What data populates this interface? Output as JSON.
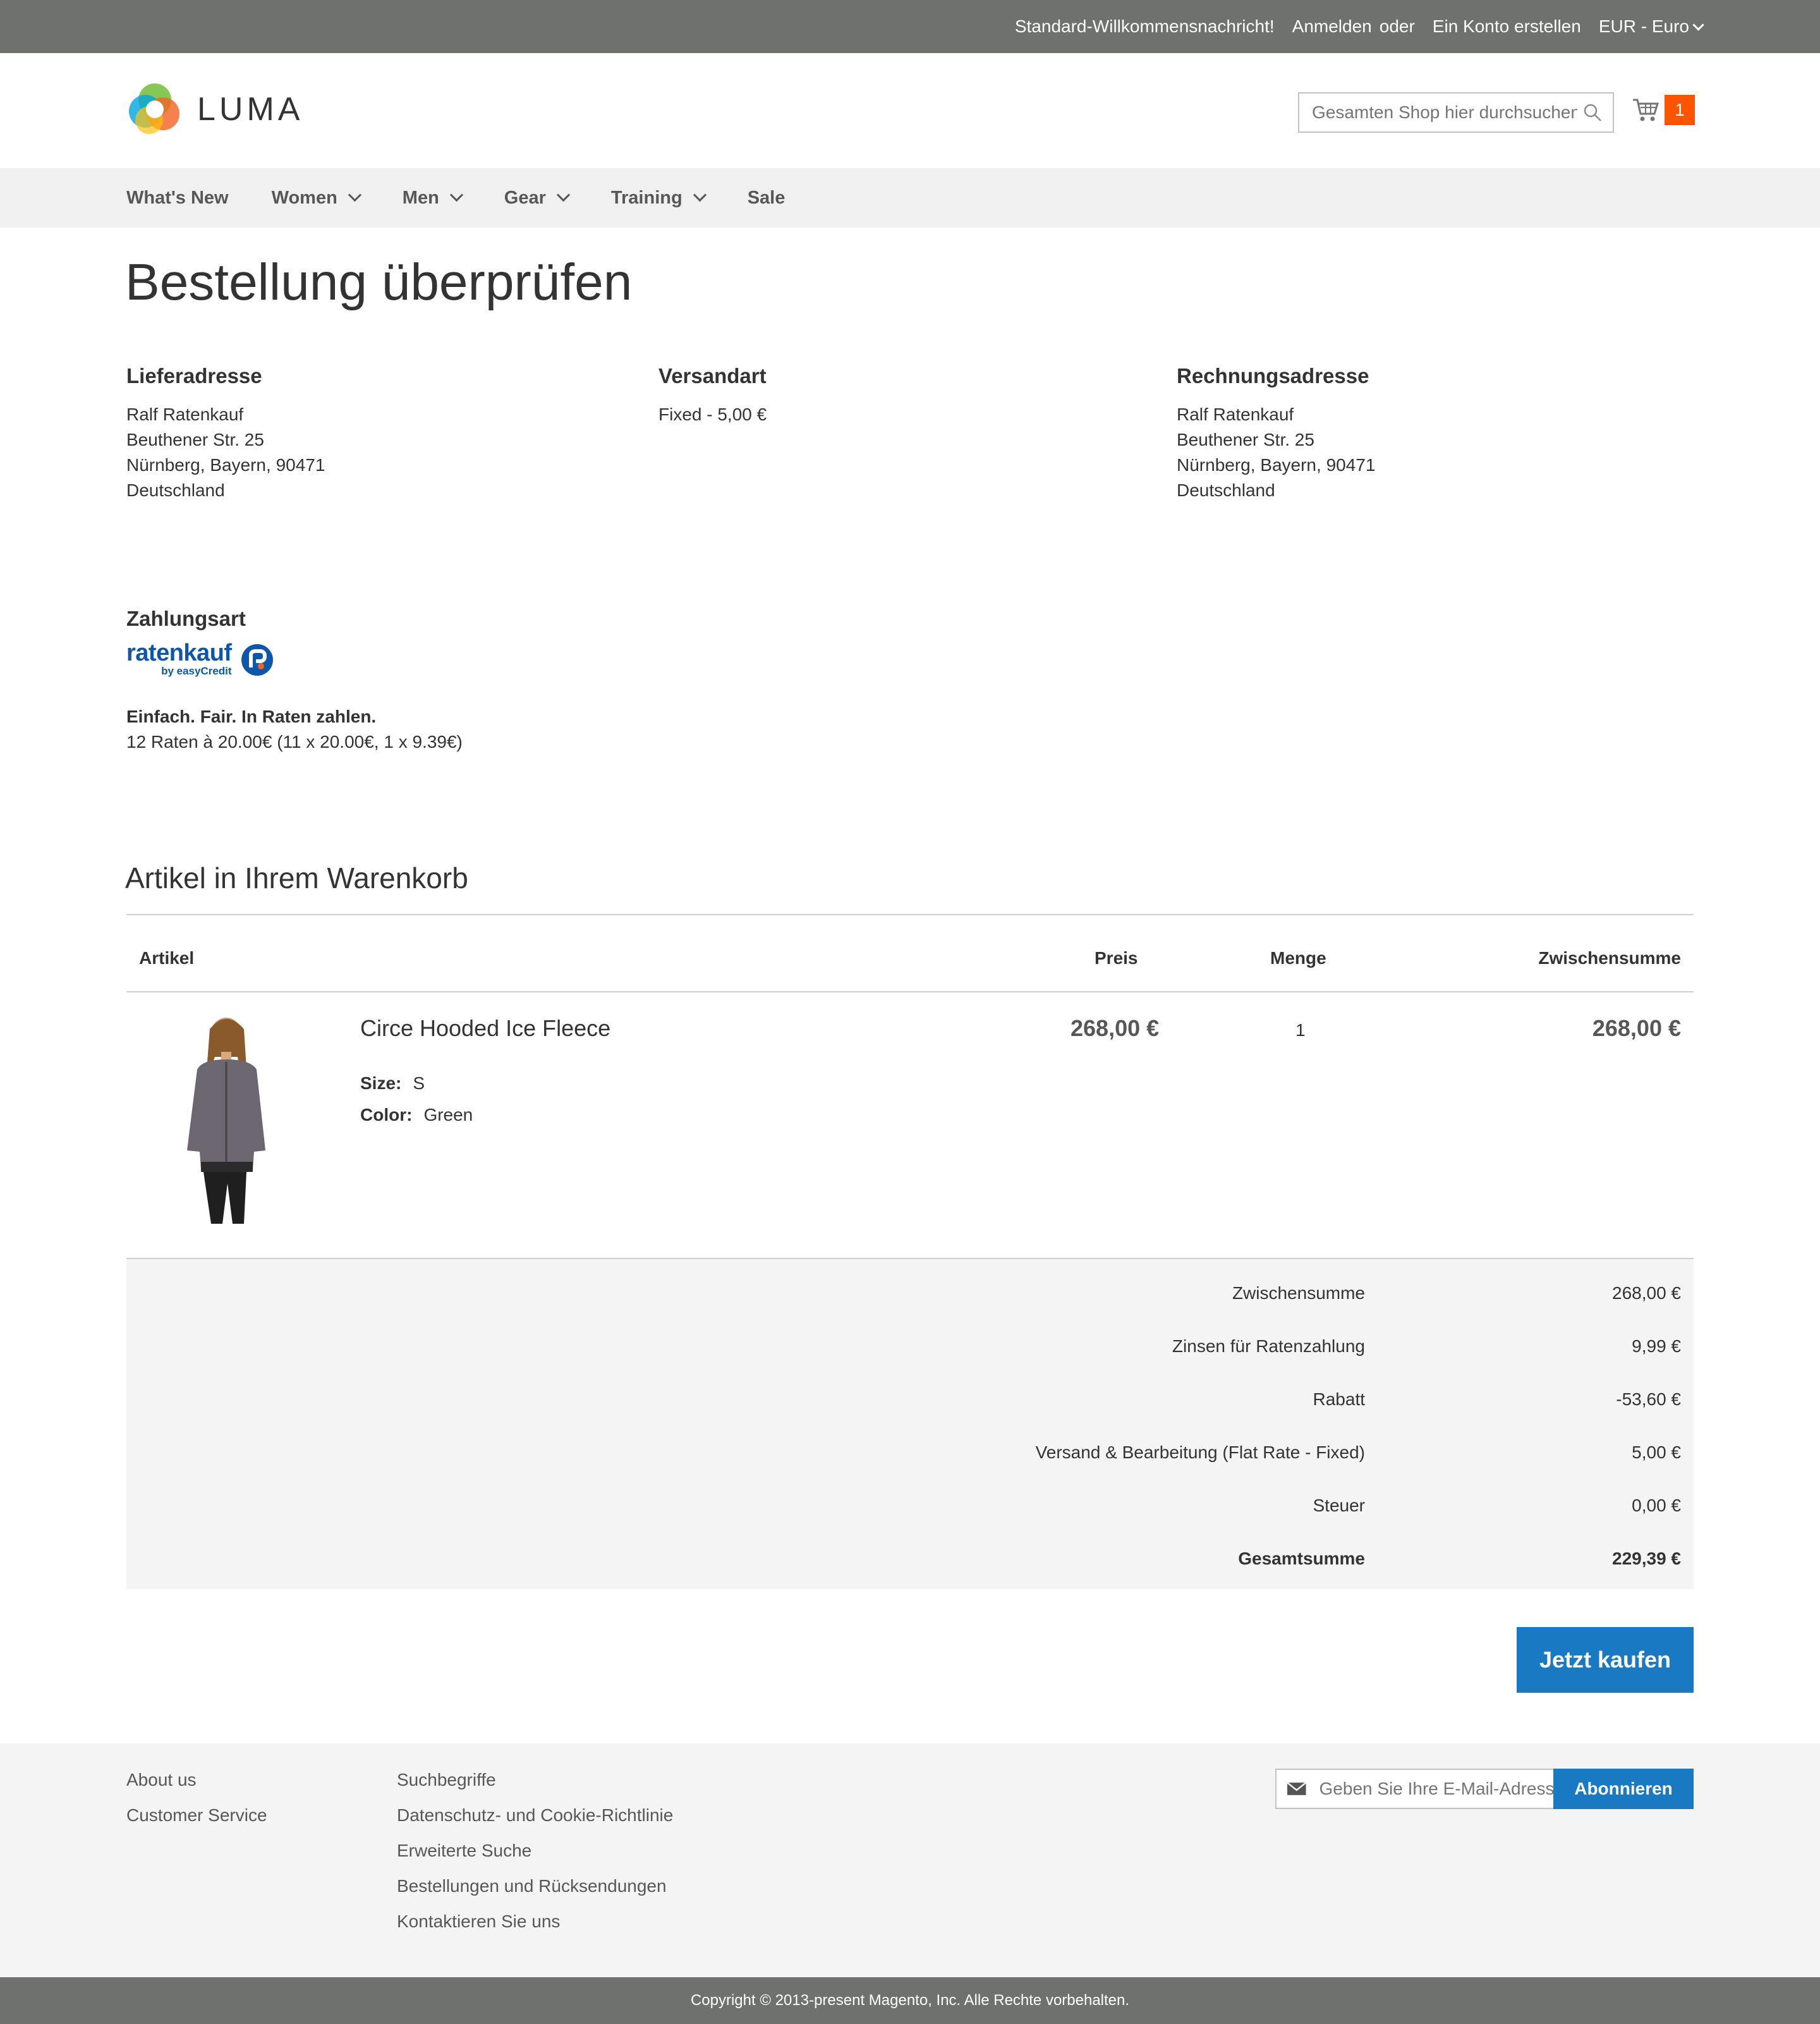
{
  "topbar": {
    "welcome": "Standard-Willkommensnachricht!",
    "login": "Anmelden",
    "or": "oder",
    "create_account": "Ein Konto erstellen",
    "currency": "EUR - Euro"
  },
  "header": {
    "logo_text": "LUMA",
    "search_placeholder": "Gesamten Shop hier durchsuchen...",
    "cart_count": "1"
  },
  "nav": {
    "items": [
      {
        "label": "What's New",
        "dropdown": false
      },
      {
        "label": "Women",
        "dropdown": true
      },
      {
        "label": "Men",
        "dropdown": true
      },
      {
        "label": "Gear",
        "dropdown": true
      },
      {
        "label": "Training",
        "dropdown": true
      },
      {
        "label": "Sale",
        "dropdown": false
      }
    ]
  },
  "page_title": "Bestellung überprüfen",
  "shipping_address": {
    "title": "Lieferadresse",
    "lines": [
      "Ralf Ratenkauf",
      "Beuthener Str. 25",
      "Nürnberg, Bayern, 90471",
      "Deutschland"
    ]
  },
  "shipping_method": {
    "title": "Versandart",
    "value": "Fixed - 5,00 €"
  },
  "billing_address": {
    "title": "Rechnungsadresse",
    "lines": [
      "Ralf Ratenkauf",
      "Beuthener Str. 25",
      "Nürnberg, Bayern, 90471",
      "Deutschland"
    ]
  },
  "payment": {
    "title": "Zahlungsart",
    "logo_text": "ratenkauf",
    "logo_sub": "by easyCredit",
    "tagline": "Einfach. Fair. In Raten zahlen.",
    "installments": "12 Raten à 20.00€ (11 x 20.00€, 1 x 9.39€)"
  },
  "cart": {
    "title": "Artikel in Ihrem Warenkorb",
    "columns": {
      "item": "Artikel",
      "price": "Preis",
      "qty": "Menge",
      "subtotal": "Zwischensumme"
    },
    "item": {
      "name": "Circe Hooded Ice Fleece",
      "size_label": "Size:",
      "size": "S",
      "color_label": "Color:",
      "color": "Green",
      "price": "268,00 €",
      "qty": "1",
      "subtotal": "268,00 €"
    }
  },
  "totals": [
    {
      "label": "Zwischensumme",
      "value": "268,00 €"
    },
    {
      "label": "Zinsen für Ratenzahlung",
      "value": "9,99 €"
    },
    {
      "label": "Rabatt",
      "value": "-53,60 €"
    },
    {
      "label": "Versand & Bearbeitung (Flat Rate - Fixed)",
      "value": "5,00 €"
    },
    {
      "label": "Steuer",
      "value": "0,00 €"
    },
    {
      "label": "Gesamtsumme",
      "value": "229,39 €"
    }
  ],
  "buy_button": "Jetzt kaufen",
  "footer": {
    "col1": [
      "About us",
      "Customer Service"
    ],
    "col2": [
      "Suchbegriffe",
      "Datenschutz- und Cookie-Richtlinie",
      "Erweiterte Suche",
      "Bestellungen und Rücksendungen",
      "Kontaktieren Sie uns"
    ],
    "newsletter_placeholder": "Geben Sie Ihre E-Mail-Adresse ein",
    "subscribe": "Abonnieren"
  },
  "copyright": "Copyright © 2013-present Magento, Inc. Alle Rechte vorbehalten.",
  "colors": {
    "topbar": "#6e716e",
    "accent_blue": "#1979c3",
    "cart_badge": "#ff5501",
    "nav_bg": "#f0f0f0",
    "totals_bg": "#f4f4f4",
    "ratenkauf_blue": "#0e56a8"
  },
  "icons": {
    "search": "search-icon",
    "cart": "cart-icon",
    "envelope": "envelope-icon",
    "chevron": "chevron-down-icon"
  }
}
